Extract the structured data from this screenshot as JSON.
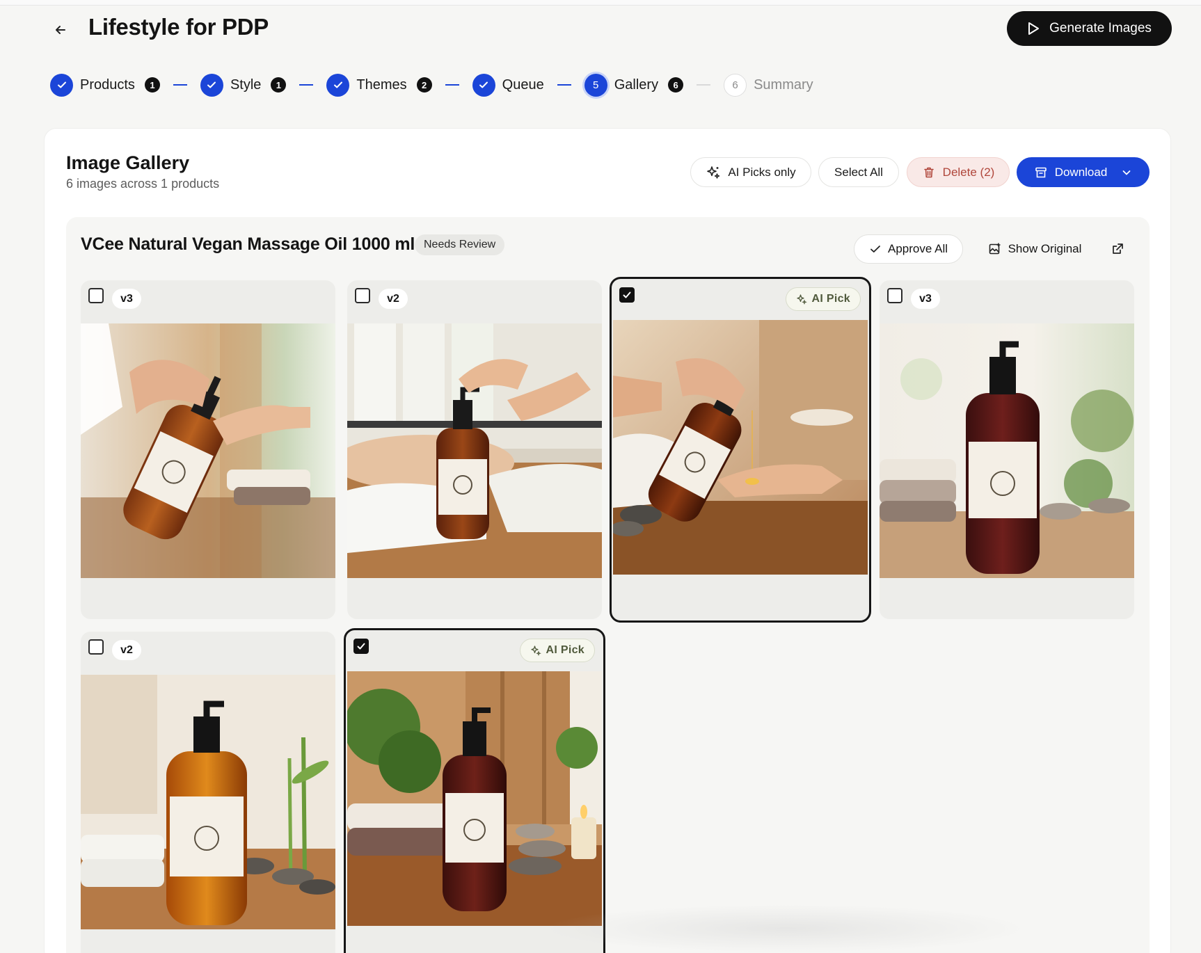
{
  "header": {
    "title": "Lifestyle for PDP",
    "generate_label": "Generate Images"
  },
  "stepper": {
    "steps": [
      {
        "label": "Products",
        "count": "1",
        "state": "done"
      },
      {
        "label": "Style",
        "count": "1",
        "state": "done"
      },
      {
        "label": "Themes",
        "count": "2",
        "state": "done"
      },
      {
        "label": "Queue",
        "state": "done"
      },
      {
        "label": "Gallery",
        "number": "5",
        "count": "6",
        "state": "current"
      },
      {
        "label": "Summary",
        "number": "6",
        "state": "pending"
      }
    ]
  },
  "gallery": {
    "title": "Image Gallery",
    "subtitle": "6 images across 1 products",
    "ai_picks_label": "AI Picks only",
    "select_all_label": "Select All",
    "delete_label": "Delete (2)",
    "download_label": "Download"
  },
  "product": {
    "name": "VCee Natural Vegan Massage Oil 1000 ml",
    "status": "Needs Review",
    "approve_all_label": "Approve All",
    "show_original_label": "Show Original"
  },
  "images": [
    {
      "version": "v3",
      "checked": false,
      "ai_pick": false
    },
    {
      "version": "v2",
      "checked": false,
      "ai_pick": false
    },
    {
      "version": "",
      "checked": true,
      "ai_pick": true,
      "ai_label": "AI Pick"
    },
    {
      "version": "v3",
      "checked": false,
      "ai_pick": false
    },
    {
      "version": "v2",
      "checked": false,
      "ai_pick": false
    },
    {
      "version": "",
      "checked": true,
      "ai_pick": true,
      "ai_label": "AI Pick"
    }
  ],
  "colors": {
    "accent": "#1b45d8",
    "dark": "#111111",
    "danger_bg": "#f9e9e7",
    "danger_text": "#b0463b"
  },
  "icons": {
    "back": "arrow-left-icon",
    "play": "play-icon",
    "check": "check-icon",
    "sparkle": "sparkle-icon",
    "trash": "trash-icon",
    "archive": "archive-icon",
    "chevron": "chevron-down-icon",
    "image_compare": "image-icon",
    "external": "external-link-icon"
  }
}
